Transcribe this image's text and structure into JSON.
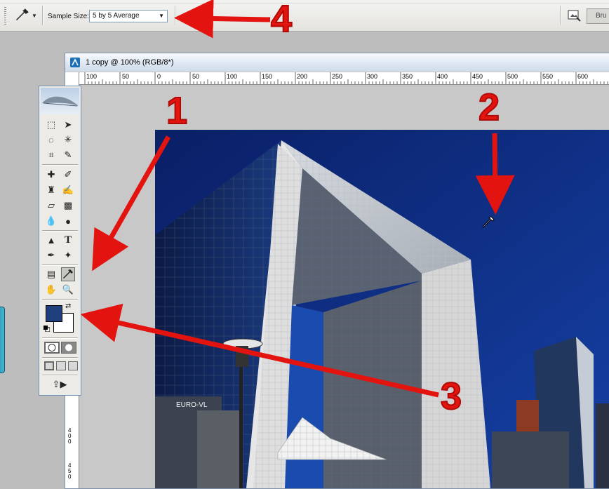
{
  "options_bar": {
    "sample_size_label": "Sample Size:",
    "sample_size_value": "5 by 5 Average",
    "brush_tab_label": "Bru"
  },
  "document": {
    "title": "1 copy @ 100% (RGB/8*)",
    "h_ruler_ticks": [
      "100",
      "50",
      "0",
      "50",
      "100",
      "150",
      "200",
      "250",
      "300",
      "350",
      "400",
      "450",
      "500",
      "550",
      "600"
    ],
    "v_ruler_ticks": [
      "400",
      "450"
    ],
    "photo_sign": "EURO-VL"
  },
  "toolbox": {
    "foreground_color": "#1e3f7c",
    "background_color": "#ffffff"
  },
  "annotations": {
    "n1": "1",
    "n2": "2",
    "n3": "3",
    "n4": "4",
    "arrow_color": "#e3140f"
  }
}
